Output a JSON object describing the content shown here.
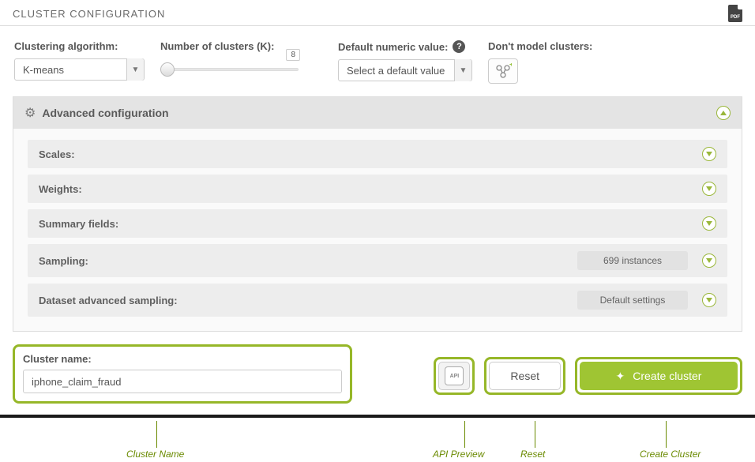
{
  "header": {
    "title": "CLUSTER CONFIGURATION"
  },
  "controls": {
    "algorithm": {
      "label": "Clustering algorithm:",
      "value": "K-means"
    },
    "k": {
      "label": "Number of clusters (K):",
      "value": "8"
    },
    "default_numeric": {
      "label": "Default numeric value:",
      "placeholder": "Select a default value"
    },
    "dont_model": {
      "label": "Don't model clusters:"
    }
  },
  "advanced": {
    "title": "Advanced configuration",
    "rows": {
      "scales": {
        "label": "Scales:"
      },
      "weights": {
        "label": "Weights:"
      },
      "summary": {
        "label": "Summary fields:"
      },
      "sampling": {
        "label": "Sampling:",
        "badge": "699 instances"
      },
      "dataset_sampling": {
        "label": "Dataset advanced sampling:",
        "badge": "Default settings"
      }
    }
  },
  "footer": {
    "cluster_name_label": "Cluster name:",
    "cluster_name_value": "iphone_claim_fraud",
    "reset_label": "Reset",
    "create_label": "Create cluster"
  },
  "captions": {
    "name": "Cluster Name",
    "api": "API Preview",
    "reset": "Reset",
    "create": "Create Cluster"
  }
}
